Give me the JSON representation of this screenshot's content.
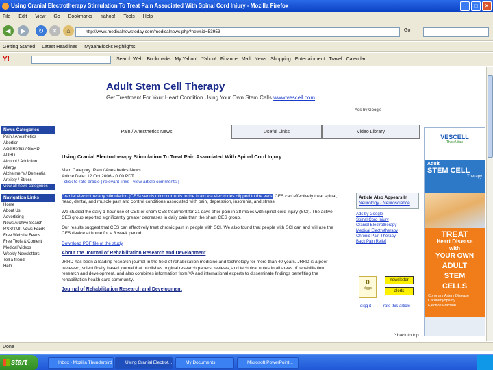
{
  "window": {
    "title": "Using Cranial Electrotherapy Stimulation To Treat Pain Associated With Spinal Cord Injury - Mozilla Firefox"
  },
  "menu": [
    "File",
    "Edit",
    "View",
    "Go",
    "Bookmarks",
    "Yahoo!",
    "Tools",
    "Help"
  ],
  "navbar": {
    "url": "http://www.medicalnewstoday.com/medicalnews.php?newsid=53953",
    "go_label": "Go"
  },
  "bookmarks": [
    "Getting Started",
    "Latest Headlines",
    "MyaahBlocks Highlights"
  ],
  "yahoo_toolbar": {
    "logo": "Y!",
    "buttons": [
      "Search Web",
      "Bookmarks",
      "My Yahoo!",
      "Yahoo!",
      "Finance",
      "Mail",
      "News",
      "Shopping",
      "Entertainment",
      "Travel",
      "Calendar"
    ]
  },
  "banner": {
    "title": "Adult Stem Cell Therapy",
    "subtitle": "Get Treatment For Your Heart Condition Using Your Own Stem Cells",
    "link": "www.vescell.com",
    "ads_by": "Ads by Google"
  },
  "left_nav": {
    "news_header": "News Categories",
    "news_items": [
      "Pain / Anesthetics",
      "Abortion",
      "Acid Reflux / GERD",
      "ADHD",
      "Alcohol / Addiction",
      "Allergy",
      "Alzheimer's / Dementia",
      "Anxiety / Stress"
    ],
    "view_all": "view all news categories",
    "nav_header": "Navigation Links",
    "nav_items": [
      "Home",
      "About Us",
      "Advertising",
      "News Archive Search",
      "RSS/XML News Feeds",
      "Free Website Feeds",
      "Free Tools & Content",
      "Medical Videos",
      "Weekly Newsletters",
      "Tell a friend",
      "Help"
    ]
  },
  "tabs": [
    "Pain / Anesthetics News",
    "Useful Links",
    "Video Library"
  ],
  "article": {
    "title": "Using Cranial Electrotherapy Stimulation To Treat Pain Associated With Spinal Cord Injury",
    "category_label": "Main Category: Pain / Anesthetics News",
    "date": "Article Date: 12 Oct 2006 - 0:00 PDT",
    "links_line": "[ click to rate article | relevant links | view article comments ]",
    "para1_hl": "Cranial electrotherapy stimulation (CES) sends microcurrents to the brain via electrodes clipped to the ears.",
    "para1_rest": " CES can effectively treat spinal, head, dental, and muscle pain and control conditions associated with pain, depression, insomnia, and stress.",
    "para2": "We studied the daily 1-hour use of CES or sham CES treatment for 21 days after pain in 38 males with spinal cord injury (SCI). The active CES group reported significantly greater decreases in daily pain than the sham CES group.",
    "para3": "Our results suggest that CES can effectively treat chronic pain in people with SCI. We also found that people with SCI can and will use the CES device at home for a 3 week period.",
    "download": "Download PDF file of the study",
    "about_head": "About the Journal of Rehabilitation Research and Development",
    "about_text": "JRRD has been a leading research journal in the field of rehabilitation medicine and technology for more than 40 years. JRRD is a peer-reviewed, scientifically based journal that publishes original research papers, reviews, and technical notes in all areas of rehabilitation research and development, and also combines information from VA and international experts to disseminate findings benefiting the rehabilitation health care community.",
    "journal_link": "Journal of Rehabilitation Research and Development"
  },
  "right_col": {
    "also_appears": "Article Also Appears In",
    "also_link": "Neurology / Neuroscience",
    "links": [
      "Ads by Google",
      "Spinal Cord Injury",
      "Cranial Electrotherapy",
      "Medical Electrotherapy",
      "Chronic Pain Therapy",
      "Back Pain Relief"
    ],
    "vote_count": "0",
    "vote_label": "diggs",
    "newsletter": "newsletter",
    "alerts": "alerts",
    "digg": "digg it",
    "rate": "rate this article",
    "back_to_top": "^ back to top"
  },
  "ad": {
    "brand": "VESCELL",
    "brand_sub": "TheraVitae",
    "blue1": "Adult",
    "blue2": "STEM CELL",
    "blue3": "Therapy",
    "o1": "TREAT",
    "o2": "Heart Disease",
    "o3": "with",
    "o4": "YOUR OWN",
    "o5": "ADULT",
    "o6": "STEM",
    "o7": "CELLS",
    "bullets": [
      "Coronary Artery Disease",
      "Cardiomyopathy",
      "Ejection Fraction"
    ]
  },
  "status": "Done",
  "taskbar": {
    "start": "start",
    "tasks": [
      "Inbox - Mozilla Thunderbird",
      "Using Cranial Electrot...",
      "My Documents",
      "Microsoft PowerPoint..."
    ]
  }
}
